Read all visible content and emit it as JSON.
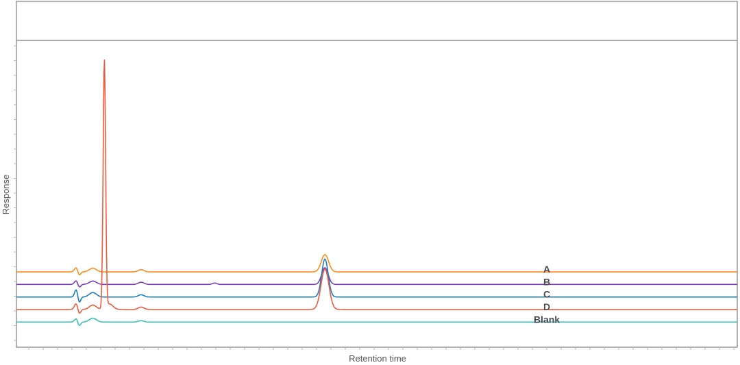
{
  "chart_data": {
    "type": "line",
    "title": "",
    "xlabel": "Retention time",
    "ylabel": "Response",
    "xlim": [
      0,
      100
    ],
    "ylim": [
      -5,
      105
    ],
    "grid": false,
    "series": [
      {
        "name": "A",
        "label": "A",
        "color": "#ff8c1a",
        "baseline": 22,
        "peaks": [
          [
            8.3,
            1.6,
            0.25
          ],
          [
            8.7,
            -1.4,
            0.2
          ],
          [
            10.6,
            1.3,
            0.5
          ],
          [
            17.3,
            0.8,
            0.4
          ],
          [
            42.8,
            6.2,
            0.5
          ]
        ]
      },
      {
        "name": "B",
        "label": "B",
        "color": "#7b3fb5",
        "baseline": 17.5,
        "peaks": [
          [
            8.3,
            1.4,
            0.25
          ],
          [
            8.7,
            -1.2,
            0.2
          ],
          [
            10.6,
            1.2,
            0.5
          ],
          [
            17.3,
            0.8,
            0.4
          ],
          [
            27.5,
            0.5,
            0.3
          ],
          [
            42.8,
            6.0,
            0.45
          ]
        ]
      },
      {
        "name": "C",
        "label": "C",
        "color": "#1a7ec2",
        "baseline": 13,
        "peaks": [
          [
            8.3,
            2.8,
            0.22
          ],
          [
            8.7,
            -2.2,
            0.2
          ],
          [
            10.6,
            1.6,
            0.5
          ],
          [
            17.3,
            0.8,
            0.4
          ],
          [
            42.8,
            13.6,
            0.45
          ]
        ]
      },
      {
        "name": "D",
        "label": "D",
        "color": "#f05a3c",
        "baseline": 8.5,
        "peaks": [
          [
            8.3,
            2.2,
            0.25
          ],
          [
            8.7,
            -1.8,
            0.2
          ],
          [
            10.6,
            1.6,
            0.5
          ],
          [
            12.2,
            89,
            0.17
          ],
          [
            12.9,
            2.0,
            0.5
          ],
          [
            17.3,
            0.9,
            0.4
          ],
          [
            42.8,
            14.5,
            0.55
          ]
        ]
      },
      {
        "name": "Blank",
        "label": "Blank",
        "color": "#35c4b5",
        "baseline": 4,
        "peaks": [
          [
            8.3,
            1.3,
            0.25
          ],
          [
            8.7,
            -1.5,
            0.2
          ],
          [
            10.6,
            1.4,
            0.5
          ],
          [
            17.3,
            0.5,
            0.4
          ]
        ]
      }
    ]
  }
}
